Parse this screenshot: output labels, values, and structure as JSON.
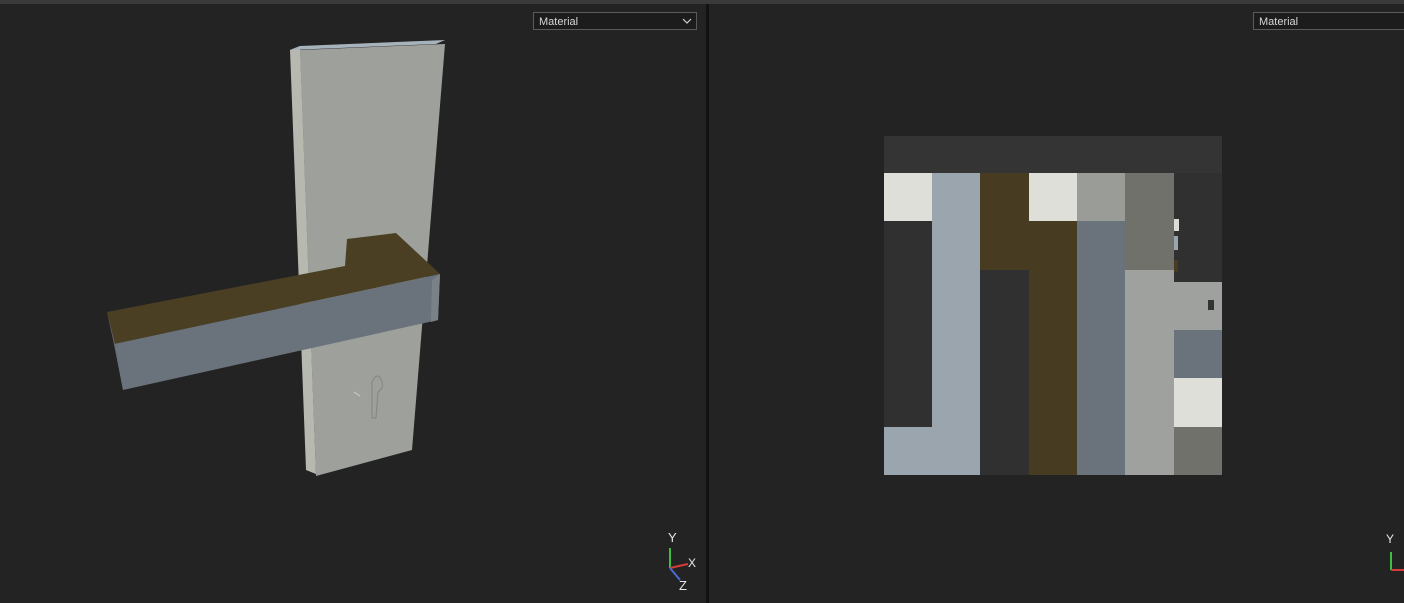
{
  "viewports": {
    "left": {
      "shading_mode": "Material",
      "axes": {
        "y": "Y",
        "x": "X",
        "z": "Z"
      }
    },
    "right": {
      "shading_mode": "Material",
      "axes": {
        "y": "Y"
      }
    }
  },
  "colors": {
    "background": "#232323",
    "plate_front": "#9ea19b",
    "plate_side": "#b4b7ae",
    "plate_top": "#a8b3bb",
    "handle_top": "#4a3f22",
    "handle_front": "#6a737b",
    "handle_end": "#6a737b",
    "uv_dark": "#303030",
    "uv_white": "#dddfd8",
    "uv_blue_grey": "#9ba5ad",
    "uv_brown": "#473b21",
    "uv_grey": "#9a9c98",
    "uv_dark_grey": "#71716c",
    "uv_slate": "#6a737b",
    "uv_light_grey": "#9fa19e"
  }
}
